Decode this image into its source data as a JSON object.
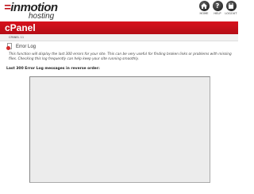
{
  "brand": {
    "name_prefix": "in",
    "name_main": "motion",
    "tagline": "hosting"
  },
  "header_icons": [
    {
      "label": "Home",
      "glyph": "home-icon"
    },
    {
      "label": "Help",
      "glyph": "help-icon"
    },
    {
      "label": "Logout",
      "glyph": "logout-icon"
    }
  ],
  "app_title": "cPanel",
  "breadcrumb": "cPanel 11",
  "section": {
    "title": "Error Log",
    "description": "This function will display the last 300 errors for your site. This can be very useful for finding broken links or problems with missing files. Checking this log frequently can help keep your site running smoothly.",
    "list_heading": "Last 300 Error Log messages in reverse order:",
    "log_contents": ""
  },
  "colors": {
    "brand_red": "#c8101a",
    "header_icon": "#333333"
  }
}
